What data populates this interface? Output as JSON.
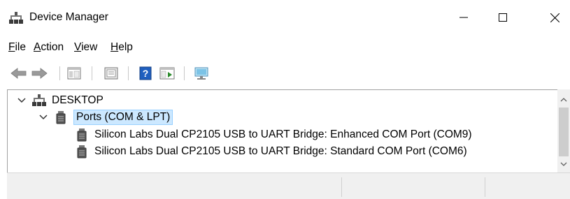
{
  "window": {
    "title": "Device Manager"
  },
  "menu": {
    "items": [
      {
        "label": "File",
        "underline": "F",
        "rest": "ile"
      },
      {
        "label": "Action",
        "underline": "A",
        "rest": "ction"
      },
      {
        "label": "View",
        "underline": "V",
        "rest": "iew"
      },
      {
        "label": "Help",
        "underline": "H",
        "rest": "elp"
      }
    ]
  },
  "toolbar": {
    "buttons": [
      {
        "name": "back-icon"
      },
      {
        "name": "forward-icon"
      },
      {
        "name": "show-hide-console-tree-icon"
      },
      {
        "name": "properties-icon"
      },
      {
        "name": "help-icon"
      },
      {
        "name": "action-pane-icon"
      },
      {
        "name": "scan-hardware-changes-icon"
      }
    ]
  },
  "tree": {
    "root": {
      "label": "DESKTOP",
      "expanded": true
    },
    "category": {
      "label": "Ports (COM & LPT)",
      "expanded": true,
      "selected": true
    },
    "devices": [
      {
        "label": "Silicon Labs Dual CP2105 USB to UART Bridge: Enhanced COM Port (COM9)"
      },
      {
        "label": "Silicon Labs Dual CP2105 USB to UART Bridge: Standard COM Port (COM6)"
      }
    ]
  },
  "colors": {
    "selection_bg": "#cce8ff",
    "selection_border": "#99d1ff",
    "help_icon_blue": "#1f5fbf"
  }
}
